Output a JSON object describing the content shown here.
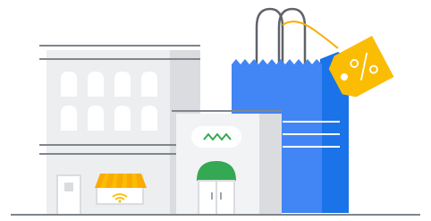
{
  "illustration": {
    "subject": "storefront-with-shopping-bag",
    "tag_symbol": "%",
    "colors": {
      "building": "#eceef0",
      "building_shade": "#dadce0",
      "outline": "#80868b",
      "bag_front": "#4285f4",
      "bag_side": "#1a73e8",
      "tag": "#fbbc04",
      "awning_stripe": "#f9ab00",
      "dome": "#34a853",
      "sign_wave": "#34a853"
    }
  }
}
